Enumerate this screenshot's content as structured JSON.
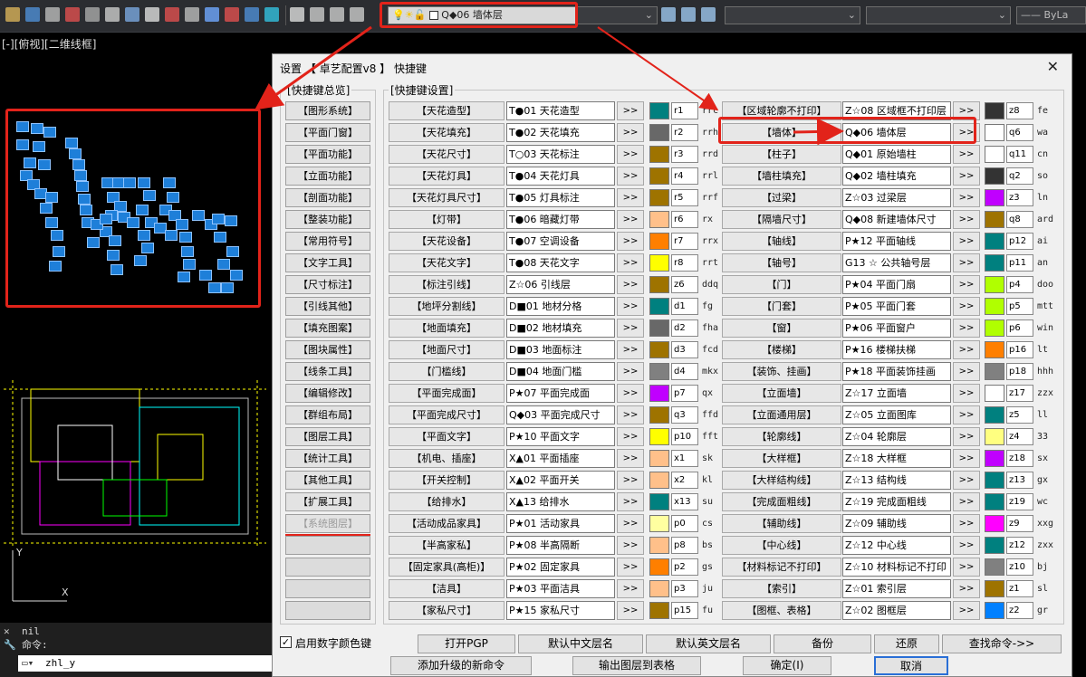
{
  "app": {
    "viewport_label": "[-][俯视][二维线框]",
    "layer_combo_value": "Q◆06 墙体层",
    "linetype_value": "ByLa",
    "command_history": "nil",
    "command_prompt": "命令:",
    "command_input": "zhl_y"
  },
  "dialog": {
    "title": "设置 【 卓艺配置v8 】 快捷键",
    "close_glyph": "✕",
    "overview_title": "[快捷键总览]",
    "settings_title": "[快捷键设置]",
    "overview_items": [
      "【图形系统】",
      "【平面门窗】",
      "【平面功能】",
      "【立面功能】",
      "【剖面功能】",
      "【整装功能】",
      "【常用符号】",
      "【文字工具】",
      "【尺寸标注】",
      "【引线其他】",
      "【填充图案】",
      "【图块属性】",
      "【线条工具】",
      "【编辑修改】",
      "【群组布局】",
      "【图层工具】",
      "【统计工具】",
      "【其他工具】",
      "【扩展工具】",
      "【系统图层】"
    ],
    "col1": [
      {
        "name": "【天花造型】",
        "layer": "T●01 天花造型",
        "color": "#00807f",
        "code": "r1",
        "key": "rrc"
      },
      {
        "name": "【天花填充】",
        "layer": "T●02 天花填充",
        "color": "#686868",
        "code": "r2",
        "key": "rrh"
      },
      {
        "name": "【天花尺寸】",
        "layer": "T○03 天花标注",
        "color": "#9e7300",
        "code": "r3",
        "key": "rrd"
      },
      {
        "name": "【天花灯具】",
        "layer": "T●04 天花灯具",
        "color": "#9e7300",
        "code": "r4",
        "key": "rrl"
      },
      {
        "name": "【天花灯具尺寸】",
        "layer": "T●05 灯具标注",
        "color": "#9e7300",
        "code": "r5",
        "key": "rrf"
      },
      {
        "name": "【灯带】",
        "layer": "T●06 暗藏灯带",
        "color": "#ffc08a",
        "code": "r6",
        "key": "rx"
      },
      {
        "name": "【天花设备】",
        "layer": "T●07 空调设备",
        "color": "#ff7f00",
        "code": "r7",
        "key": "rrx"
      },
      {
        "name": "【天花文字】",
        "layer": "T●08 天花文字",
        "color": "#ffff00",
        "code": "r8",
        "key": "rrt"
      },
      {
        "name": "【标注引线】",
        "layer": "Z☆06 引线层",
        "color": "#9e7300",
        "code": "z6",
        "key": "ddq"
      },
      {
        "name": "【地坪分割线】",
        "layer": "D■01 地材分格",
        "color": "#00807f",
        "code": "d1",
        "key": "fg"
      },
      {
        "name": "【地面填充】",
        "layer": "D■02 地材填充",
        "color": "#686868",
        "code": "d2",
        "key": "fha"
      },
      {
        "name": "【地面尺寸】",
        "layer": "D■03 地面标注",
        "color": "#9e7300",
        "code": "d3",
        "key": "fcd"
      },
      {
        "name": "【门槛线】",
        "layer": "D■04 地面门槛",
        "color": "#808080",
        "code": "d4",
        "key": "mkx"
      },
      {
        "name": "【平面完成面】",
        "layer": "P★07 平面完成面",
        "color": "#c000ff",
        "code": "p7",
        "key": "qx"
      },
      {
        "name": "【平面完成尺寸】",
        "layer": "Q◆03 平面完成尺寸",
        "color": "#9e7300",
        "code": "q3",
        "key": "ffd"
      },
      {
        "name": "【平面文字】",
        "layer": "P★10 平面文字",
        "color": "#ffff00",
        "code": "p10",
        "key": "fft"
      },
      {
        "name": "【机电、插座】",
        "layer": "X▲01 平面插座",
        "color": "#ffc08a",
        "code": "x1",
        "key": "sk"
      },
      {
        "name": "【开关控制】",
        "layer": "X▲02 平面开关",
        "color": "#ffc08a",
        "code": "x2",
        "key": "kl"
      },
      {
        "name": "【给排水】",
        "layer": "X▲13 给排水",
        "color": "#00807f",
        "code": "x13",
        "key": "su"
      },
      {
        "name": "【活动成品家具】",
        "layer": "P★01 活动家具",
        "color": "#ffffa0",
        "code": "p0",
        "key": "cs"
      },
      {
        "name": "【半高家私】",
        "layer": "P★08 半高隔断",
        "color": "#ffc08a",
        "code": "p8",
        "key": "bs"
      },
      {
        "name": "【固定家具(高柜)】",
        "layer": "P★02 固定家具",
        "color": "#ff7f00",
        "code": "p2",
        "key": "gs"
      },
      {
        "name": "【洁具】",
        "layer": "P★03 平面洁具",
        "color": "#ffc08a",
        "code": "p3",
        "key": "ju"
      },
      {
        "name": "【家私尺寸】",
        "layer": "P★15 家私尺寸",
        "color": "#9e7300",
        "code": "p15",
        "key": "fu"
      }
    ],
    "col2": [
      {
        "name": "【区域轮廓不打印】",
        "layer": "Z☆08 区域框不打印层",
        "color": "#333333",
        "code": "z8",
        "key": "fe"
      },
      {
        "name": "【墙体】",
        "layer": "Q◆06 墙体层",
        "color": "#ffffff",
        "code": "q6",
        "key": "wa"
      },
      {
        "name": "【柱子】",
        "layer": "Q◆01 原始墙柱",
        "color": "#ffffff",
        "code": "q11",
        "key": "cn"
      },
      {
        "name": "【墙柱填充】",
        "layer": "Q◆02 墙柱填充",
        "color": "#333333",
        "code": "q2",
        "key": "so"
      },
      {
        "name": "【过梁】",
        "layer": "Z☆03 过梁层",
        "color": "#c000ff",
        "code": "z3",
        "key": "ln"
      },
      {
        "name": "【隔墙尺寸】",
        "layer": "Q◆08 新建墙体尺寸",
        "color": "#9e7300",
        "code": "q8",
        "key": "ard"
      },
      {
        "name": "【轴线】",
        "layer": "P★12 平面轴线",
        "color": "#00807f",
        "code": "p12",
        "key": "ai"
      },
      {
        "name": "【轴号】",
        "layer": "G13 ☆ 公共轴号层",
        "color": "#00807f",
        "code": "p11",
        "key": "an"
      },
      {
        "name": "【门】",
        "layer": "P★04 平面门扇",
        "color": "#b0ff00",
        "code": "p4",
        "key": "doo"
      },
      {
        "name": "【门套】",
        "layer": "P★05 平面门套",
        "color": "#b0ff00",
        "code": "p5",
        "key": "mtt"
      },
      {
        "name": "【窗】",
        "layer": "P★06 平面窗户",
        "color": "#b0ff00",
        "code": "p6",
        "key": "win"
      },
      {
        "name": "【楼梯】",
        "layer": "P★16 楼梯扶梯",
        "color": "#ff7f00",
        "code": "p16",
        "key": "lt"
      },
      {
        "name": "【装饰、挂画】",
        "layer": "P★18 平面装饰挂画",
        "color": "#808080",
        "code": "p18",
        "key": "hhh"
      },
      {
        "name": "【立面墙】",
        "layer": "Z☆17 立面墙",
        "color": "#ffffff",
        "code": "z17",
        "key": "zzx"
      },
      {
        "name": "【立面通用层】",
        "layer": "Z☆05 立面图库",
        "color": "#00807f",
        "code": "z5",
        "key": "ll"
      },
      {
        "name": "【轮廓线】",
        "layer": "Z☆04 轮廓层",
        "color": "#ffff80",
        "code": "z4",
        "key": "33"
      },
      {
        "name": "【大样框】",
        "layer": "Z☆18 大样框",
        "color": "#c000ff",
        "code": "z18",
        "key": "sx"
      },
      {
        "name": "【大样结构线】",
        "layer": "Z☆13 结构线",
        "color": "#00807f",
        "code": "z13",
        "key": "gx"
      },
      {
        "name": "【完成面粗线】",
        "layer": "Z☆19 完成面粗线",
        "color": "#00807f",
        "code": "z19",
        "key": "wc"
      },
      {
        "name": "【辅助线】",
        "layer": "Z☆09 辅助线",
        "color": "#ff00ff",
        "code": "z9",
        "key": "xxg"
      },
      {
        "name": "【中心线】",
        "layer": "Z☆12 中心线",
        "color": "#00807f",
        "code": "z12",
        "key": "zxx"
      },
      {
        "name": "【材料标记不打印】",
        "layer": "Z☆10 材料标记不打印",
        "color": "#808080",
        "code": "z10",
        "key": "bj"
      },
      {
        "name": "【索引】",
        "layer": "Z☆01 索引层",
        "color": "#9e7300",
        "code": "z1",
        "key": "sl"
      },
      {
        "name": "【图框、表格】",
        "layer": "Z☆02 图框层",
        "color": "#0080ff",
        "code": "z2",
        "key": "gr"
      }
    ],
    "arrow_label": ">>",
    "checkbox_label": "启用数字颜色键",
    "buttons_row1": [
      "打开PGP",
      "默认中文层名",
      "默认英文层名",
      "备份",
      "还原",
      "查找命令->>"
    ],
    "buttons_row2": [
      "添加升级的新命令",
      "输出图层到表格",
      "确定(I)",
      "取消"
    ]
  }
}
